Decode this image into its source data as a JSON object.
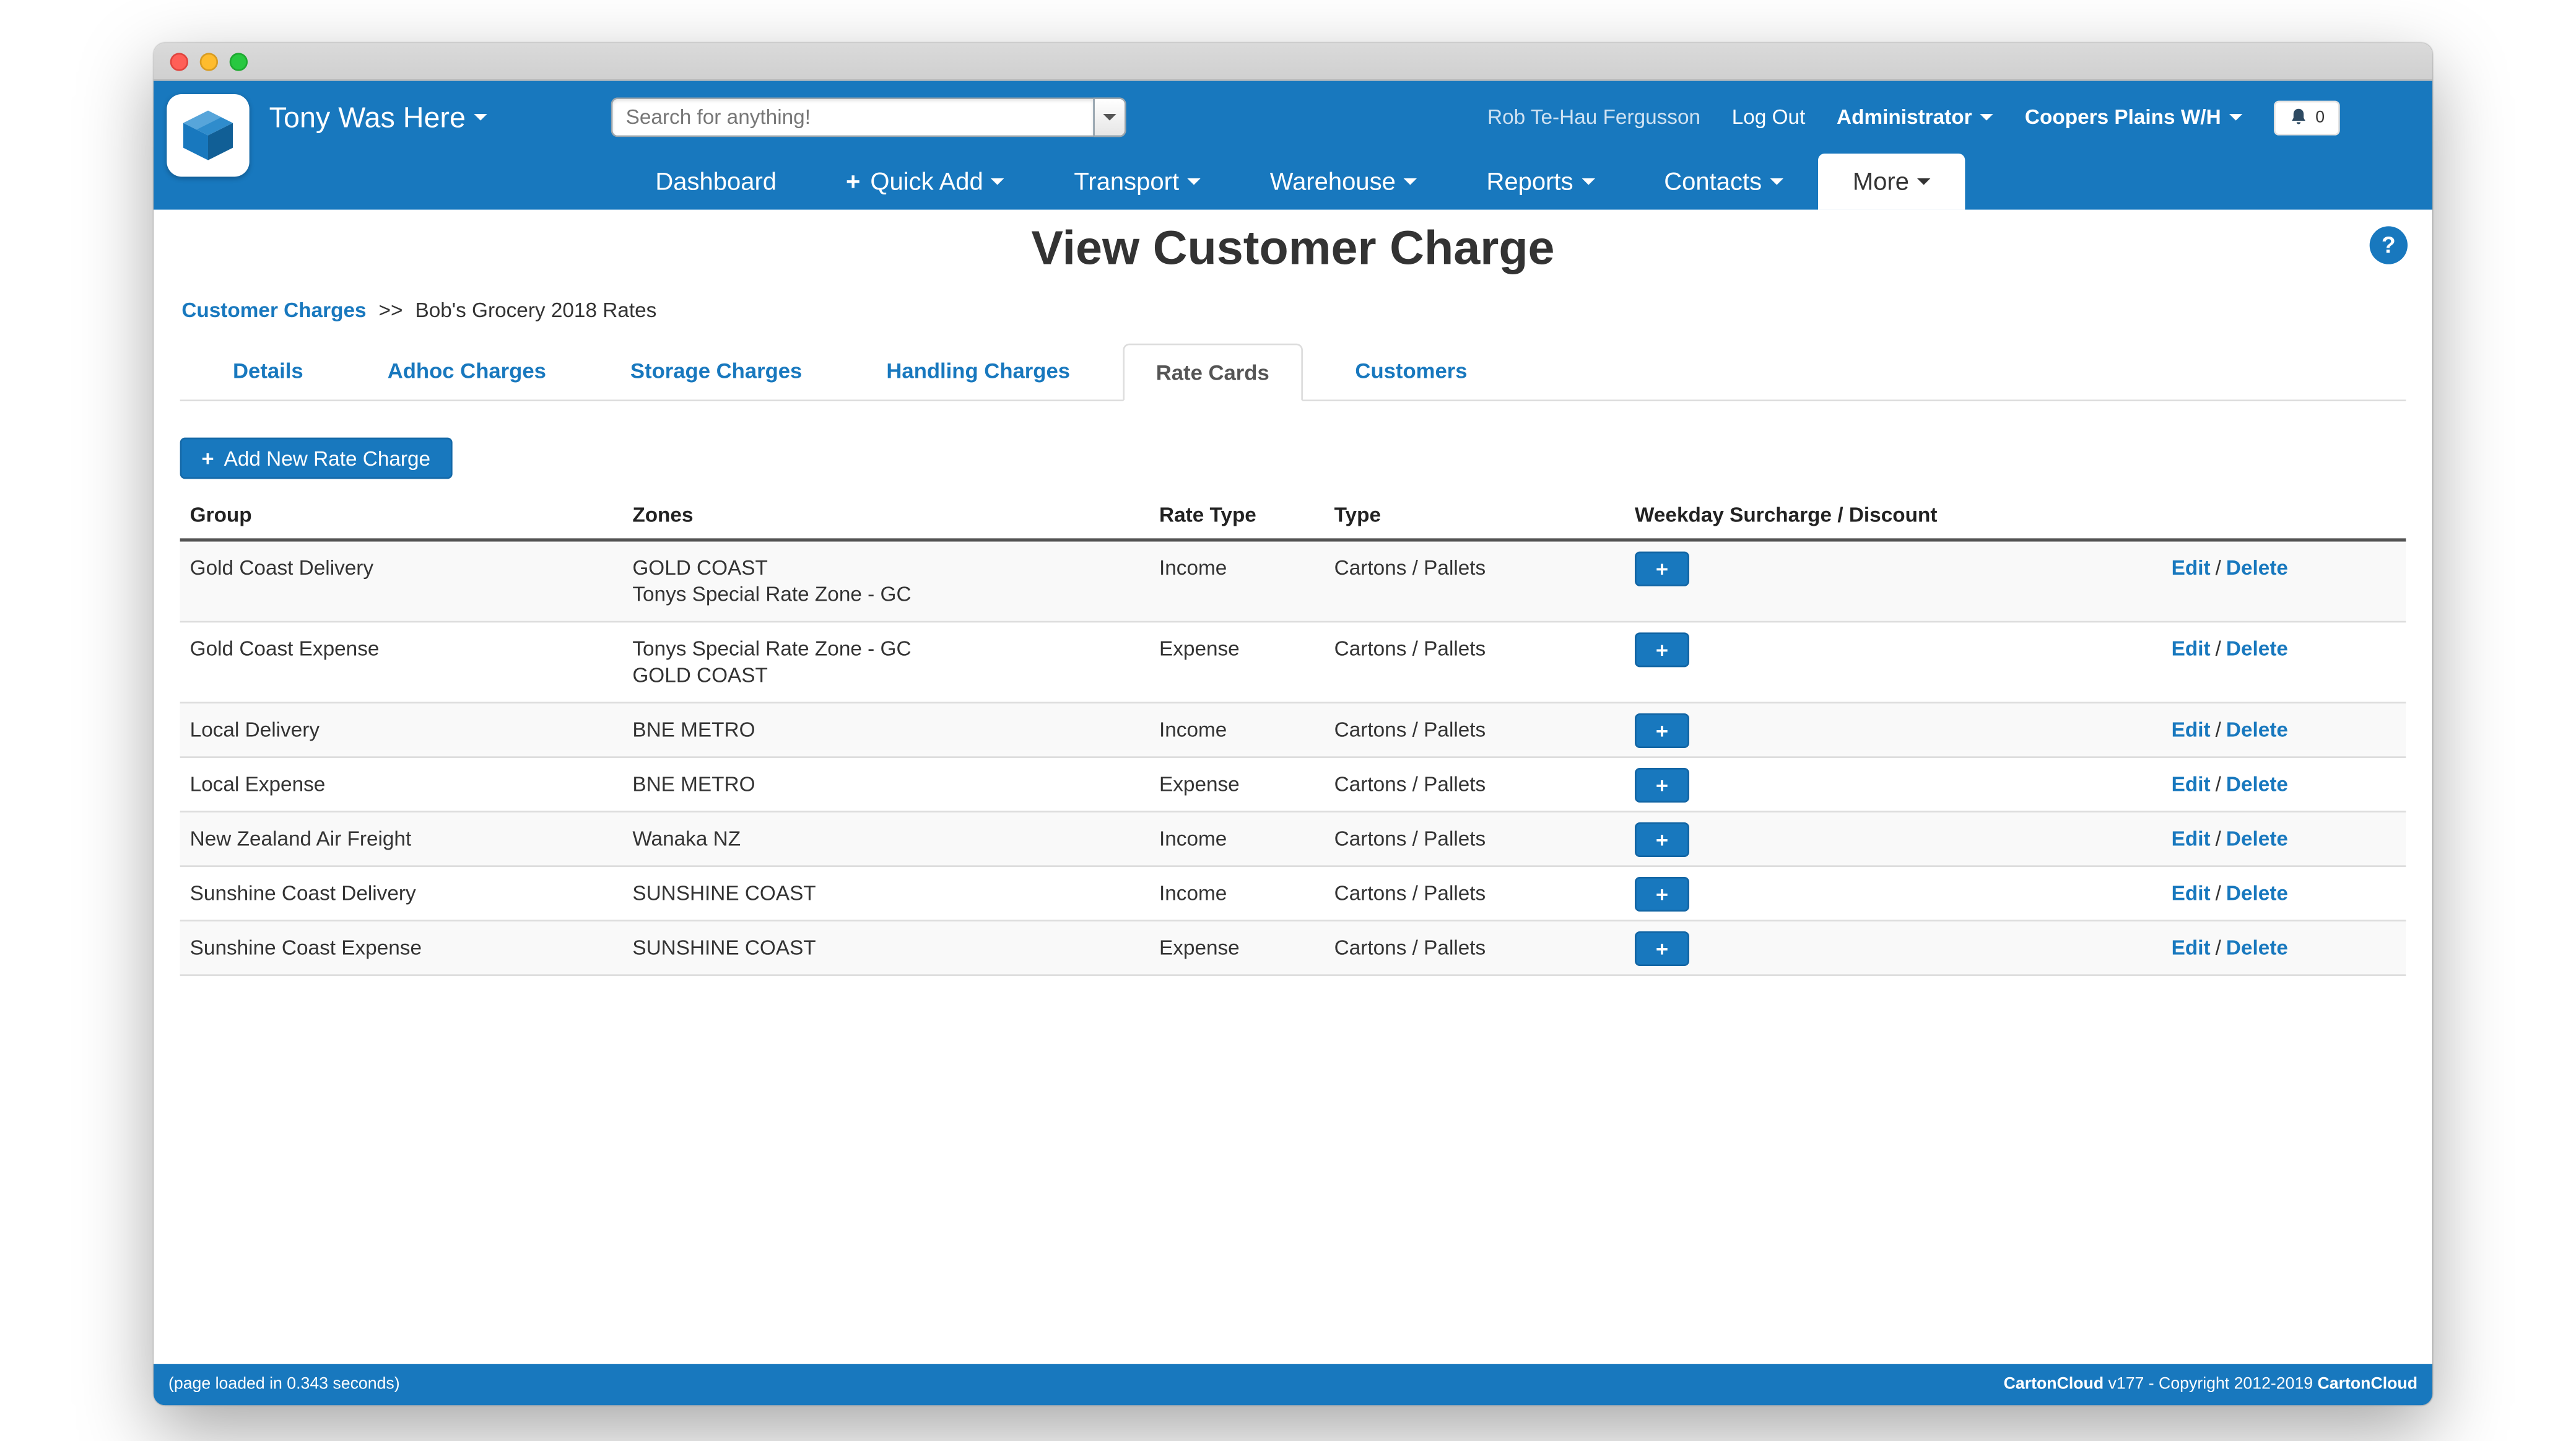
{
  "colors": {
    "primary_blue": "#1878be"
  },
  "icons": {
    "plus": "+",
    "help": "?"
  },
  "header": {
    "brand": "Tony Was Here",
    "search_placeholder": "Search for anything!",
    "user_name": "Rob Te-Hau Fergusson",
    "logout": "Log Out",
    "role": "Administrator",
    "warehouse": "Coopers Plains W/H",
    "notification_count": "0"
  },
  "nav": {
    "items": [
      {
        "label": "Dashboard"
      },
      {
        "label": "Quick Add"
      },
      {
        "label": "Transport"
      },
      {
        "label": "Warehouse"
      },
      {
        "label": "Reports"
      },
      {
        "label": "Contacts"
      },
      {
        "label": "More"
      }
    ]
  },
  "page": {
    "title": "View Customer Charge",
    "breadcrumb": {
      "link": "Customer Charges",
      "separator": ">>",
      "current": "Bob's Grocery 2018 Rates"
    }
  },
  "tabs": [
    "Details",
    "Adhoc Charges",
    "Storage Charges",
    "Handling Charges",
    "Rate Cards",
    "Customers"
  ],
  "actions": {
    "add_button": "Add New Rate Charge"
  },
  "table": {
    "headers": {
      "group": "Group",
      "zones": "Zones",
      "rate_type": "Rate Type",
      "type": "Type",
      "weekday": "Weekday Surcharge / Discount"
    },
    "edit_label": "Edit",
    "delete_label": "Delete",
    "action_separator": "/",
    "rows": [
      {
        "group": "Gold Coast Delivery",
        "zones": [
          "GOLD COAST",
          "Tonys Special Rate Zone - GC"
        ],
        "rate_type": "Income",
        "type": "Cartons / Pallets"
      },
      {
        "group": "Gold Coast Expense",
        "zones": [
          "Tonys Special Rate Zone - GC",
          "GOLD COAST"
        ],
        "rate_type": "Expense",
        "type": "Cartons / Pallets"
      },
      {
        "group": "Local Delivery",
        "zones": [
          "BNE METRO"
        ],
        "rate_type": "Income",
        "type": "Cartons / Pallets"
      },
      {
        "group": "Local Expense",
        "zones": [
          "BNE METRO"
        ],
        "rate_type": "Expense",
        "type": "Cartons / Pallets"
      },
      {
        "group": "New Zealand Air Freight",
        "zones": [
          "Wanaka NZ"
        ],
        "rate_type": "Income",
        "type": "Cartons / Pallets"
      },
      {
        "group": "Sunshine Coast Delivery",
        "zones": [
          "SUNSHINE COAST"
        ],
        "rate_type": "Income",
        "type": "Cartons / Pallets"
      },
      {
        "group": "Sunshine Coast Expense",
        "zones": [
          "SUNSHINE COAST"
        ],
        "rate_type": "Expense",
        "type": "Cartons / Pallets"
      }
    ]
  },
  "footer": {
    "left": "(page loaded in 0.343 seconds)",
    "right_brand_1": "CartonCloud",
    "right_text": " v177 - Copyright 2012-2019 ",
    "right_brand_2": "CartonCloud"
  }
}
